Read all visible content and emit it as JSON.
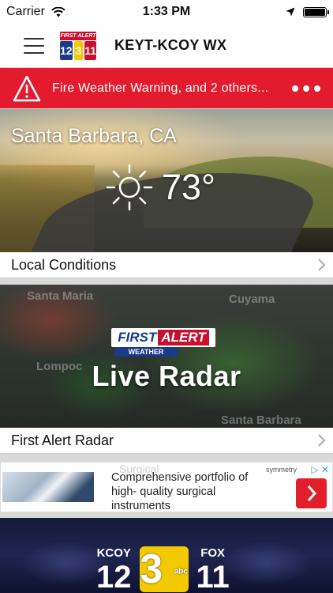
{
  "status_bar": {
    "carrier": "Carrier",
    "time": "1:33 PM"
  },
  "header": {
    "logo": {
      "top_text": "FIRST ALERT",
      "left_num": "12",
      "middle_num": "3",
      "right_num": "11",
      "colors": {
        "left": "#1a3a8a",
        "middle": "#f4c900",
        "right": "#c8102e"
      }
    },
    "title": "KEYT-KCOY WX"
  },
  "alert": {
    "text": "Fire Weather Warning, and 2 others...",
    "color": "#e31b2e"
  },
  "conditions": {
    "city": "Santa Barbara, CA",
    "temperature": "73°",
    "icon": "sunny-icon",
    "footer_label": "Local Conditions"
  },
  "radar": {
    "logo_first": "FIRST",
    "logo_alert": "ALERT",
    "logo_sub": "WEATHER",
    "title": "Live Radar",
    "map_labels": [
      "Santa Maria",
      "Cuyama",
      "Lompoc",
      "Santa Barbara"
    ],
    "footer_label": "First Alert Radar"
  },
  "ad": {
    "ghost_text": "Surgical",
    "text": "Comprehensive portfolio of high- quality surgical instruments",
    "brand": "symmetry",
    "choices": "▷ ✕"
  },
  "news": {
    "logo1_small": "KCOY",
    "logo1_big": "12",
    "logo2": "3",
    "logo2_small": "abc",
    "logo3_small": "FOX",
    "logo3_big": "11"
  }
}
